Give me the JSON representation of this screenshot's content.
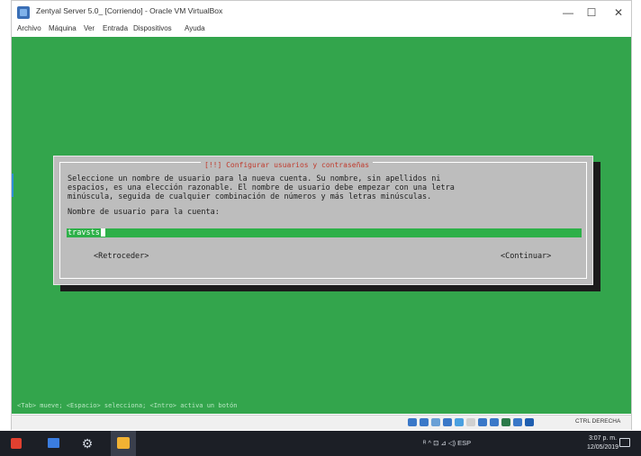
{
  "window": {
    "title": "Zentyal Server 5.0_ [Corriendo] - Oracle VM VirtualBox",
    "controls": {
      "minimize": "—",
      "maximize": "☐",
      "close": "✕"
    }
  },
  "menu": [
    "Archivo",
    "Máquina",
    "Ver",
    "Entrada",
    "Dispositivos",
    "Ayuda"
  ],
  "dialog": {
    "title": "[!!] Configurar usuarios y contraseñas",
    "description": "Seleccione un nombre de usuario para la nueva cuenta. Su nombre, sin apellidos ni\nespacios, es una elección razonable. El nombre de usuario debe empezar con una letra\nminúscula, seguida de cualquier combinación de números y más letras minúsculas.",
    "field_label": "Nombre de usuario para la cuenta:",
    "field_value": "travsts",
    "back_button": "<Retroceder>",
    "continue_button": "<Continuar>"
  },
  "help_line": "<Tab> mueve; <Espacio> selecciona; <Intro> activa un botón",
  "statusbar": {
    "host_key": "CTRL DERECHA",
    "icons": [
      "hdd-icon",
      "optical-disc-icon",
      "audio-icon",
      "network-icon",
      "usb-icon",
      "shared-folder-icon",
      "display-icon",
      "recording-icon",
      "cpu-icon",
      "mouse-integration-icon",
      "host-key-icon"
    ],
    "icon_colors": [
      "#3a78c8",
      "#3a78c8",
      "#6aa0d6",
      "#3a78c8",
      "#4aa0e0",
      "#d0d0d0",
      "#3a78c8",
      "#3a78c8",
      "#2c7a4a",
      "#3a78c8",
      "#1f5fb0"
    ]
  },
  "taskbar": {
    "tray_text": "ᴿ  ^  ⊡  ⊿  ◁)  ESP",
    "time": "3:07 p. m.",
    "date": "12/05/2019"
  },
  "colors": {
    "vm_background": "#33a54c",
    "dialog": "#bdbdbd",
    "dialog_title": "#c0392b",
    "input": "#2db048",
    "taskbar": "#1c1f26"
  }
}
